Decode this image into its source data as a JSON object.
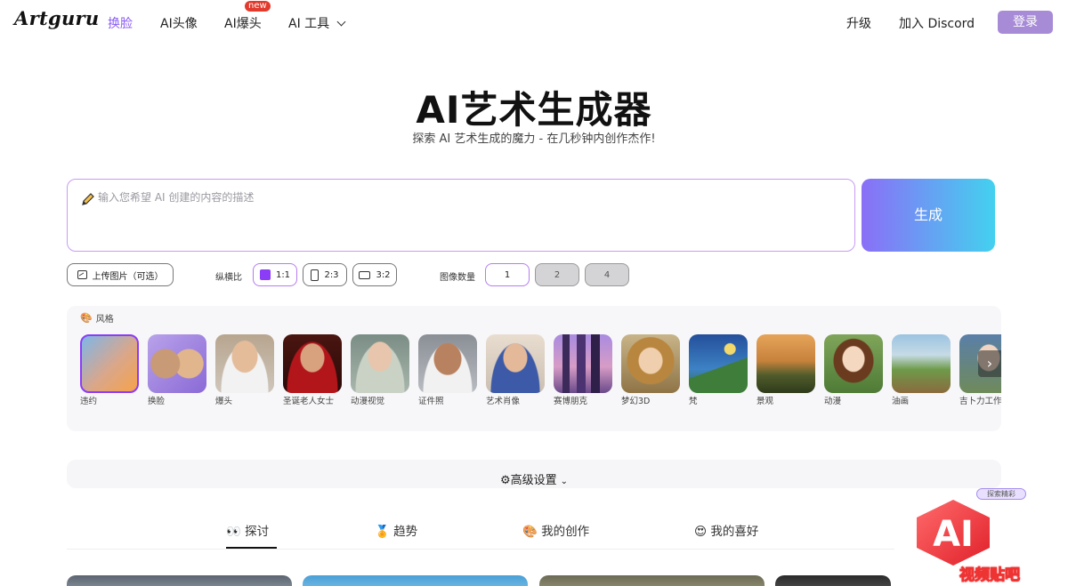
{
  "nav": {
    "logo": "Artguru",
    "items": [
      "换脸",
      "AI头像",
      "AI爆头",
      "AI 工具"
    ],
    "new_badge": "new",
    "upgrade": "升级",
    "discord": "加入 Discord",
    "login": "登录",
    "accent": "#8b5cf6"
  },
  "hero": {
    "title": "AI艺术生成器",
    "subtitle": "探索 AI 艺术生成的魔力 - 在几秒钟内创作杰作!"
  },
  "prompt": {
    "placeholder": "输入您希望 AI 创建的内容的描述",
    "value": "",
    "generate": "生成"
  },
  "options": {
    "upload": "上传图片（可选）",
    "aspect_label": "纵横比",
    "ratios": [
      "1:1",
      "2:3",
      "3:2"
    ],
    "selected_ratio": "1:1",
    "count_label": "图像数量",
    "counts": [
      "1",
      "2",
      "4"
    ],
    "selected_count": "1"
  },
  "styles": {
    "heading": "风格",
    "items": [
      {
        "name": "违约",
        "icon": "gradient-swatch"
      },
      {
        "name": "换脸",
        "icon": "face-swap"
      },
      {
        "name": "爆头",
        "icon": "portrait"
      },
      {
        "name": "圣诞老人女士",
        "icon": "portrait"
      },
      {
        "name": "动漫视觉",
        "icon": "portrait"
      },
      {
        "name": "证件照",
        "icon": "portrait"
      },
      {
        "name": "艺术肖像",
        "icon": "portrait"
      },
      {
        "name": "赛博朋克",
        "icon": "city"
      },
      {
        "name": "梦幻3D",
        "icon": "portrait"
      },
      {
        "name": "梵",
        "icon": "landscape"
      },
      {
        "name": "景观",
        "icon": "landscape"
      },
      {
        "name": "动漫",
        "icon": "anime"
      },
      {
        "name": "油画",
        "icon": "landscape"
      },
      {
        "name": "吉卜力工作室",
        "icon": "anime"
      }
    ],
    "selected": "违约"
  },
  "advanced": {
    "label": "高级设置"
  },
  "tabs": [
    {
      "label": "探讨",
      "icon": "eyes-icon"
    },
    {
      "label": "趋势",
      "icon": "medal-icon"
    },
    {
      "label": "我的创作",
      "icon": "palette-icon"
    },
    {
      "label": "我的喜好",
      "icon": "heart-eyes-icon"
    }
  ],
  "active_tab": "探讨",
  "watermark": {
    "chip": "探索精彩",
    "brand": "AI",
    "text": "视频贴吧"
  }
}
